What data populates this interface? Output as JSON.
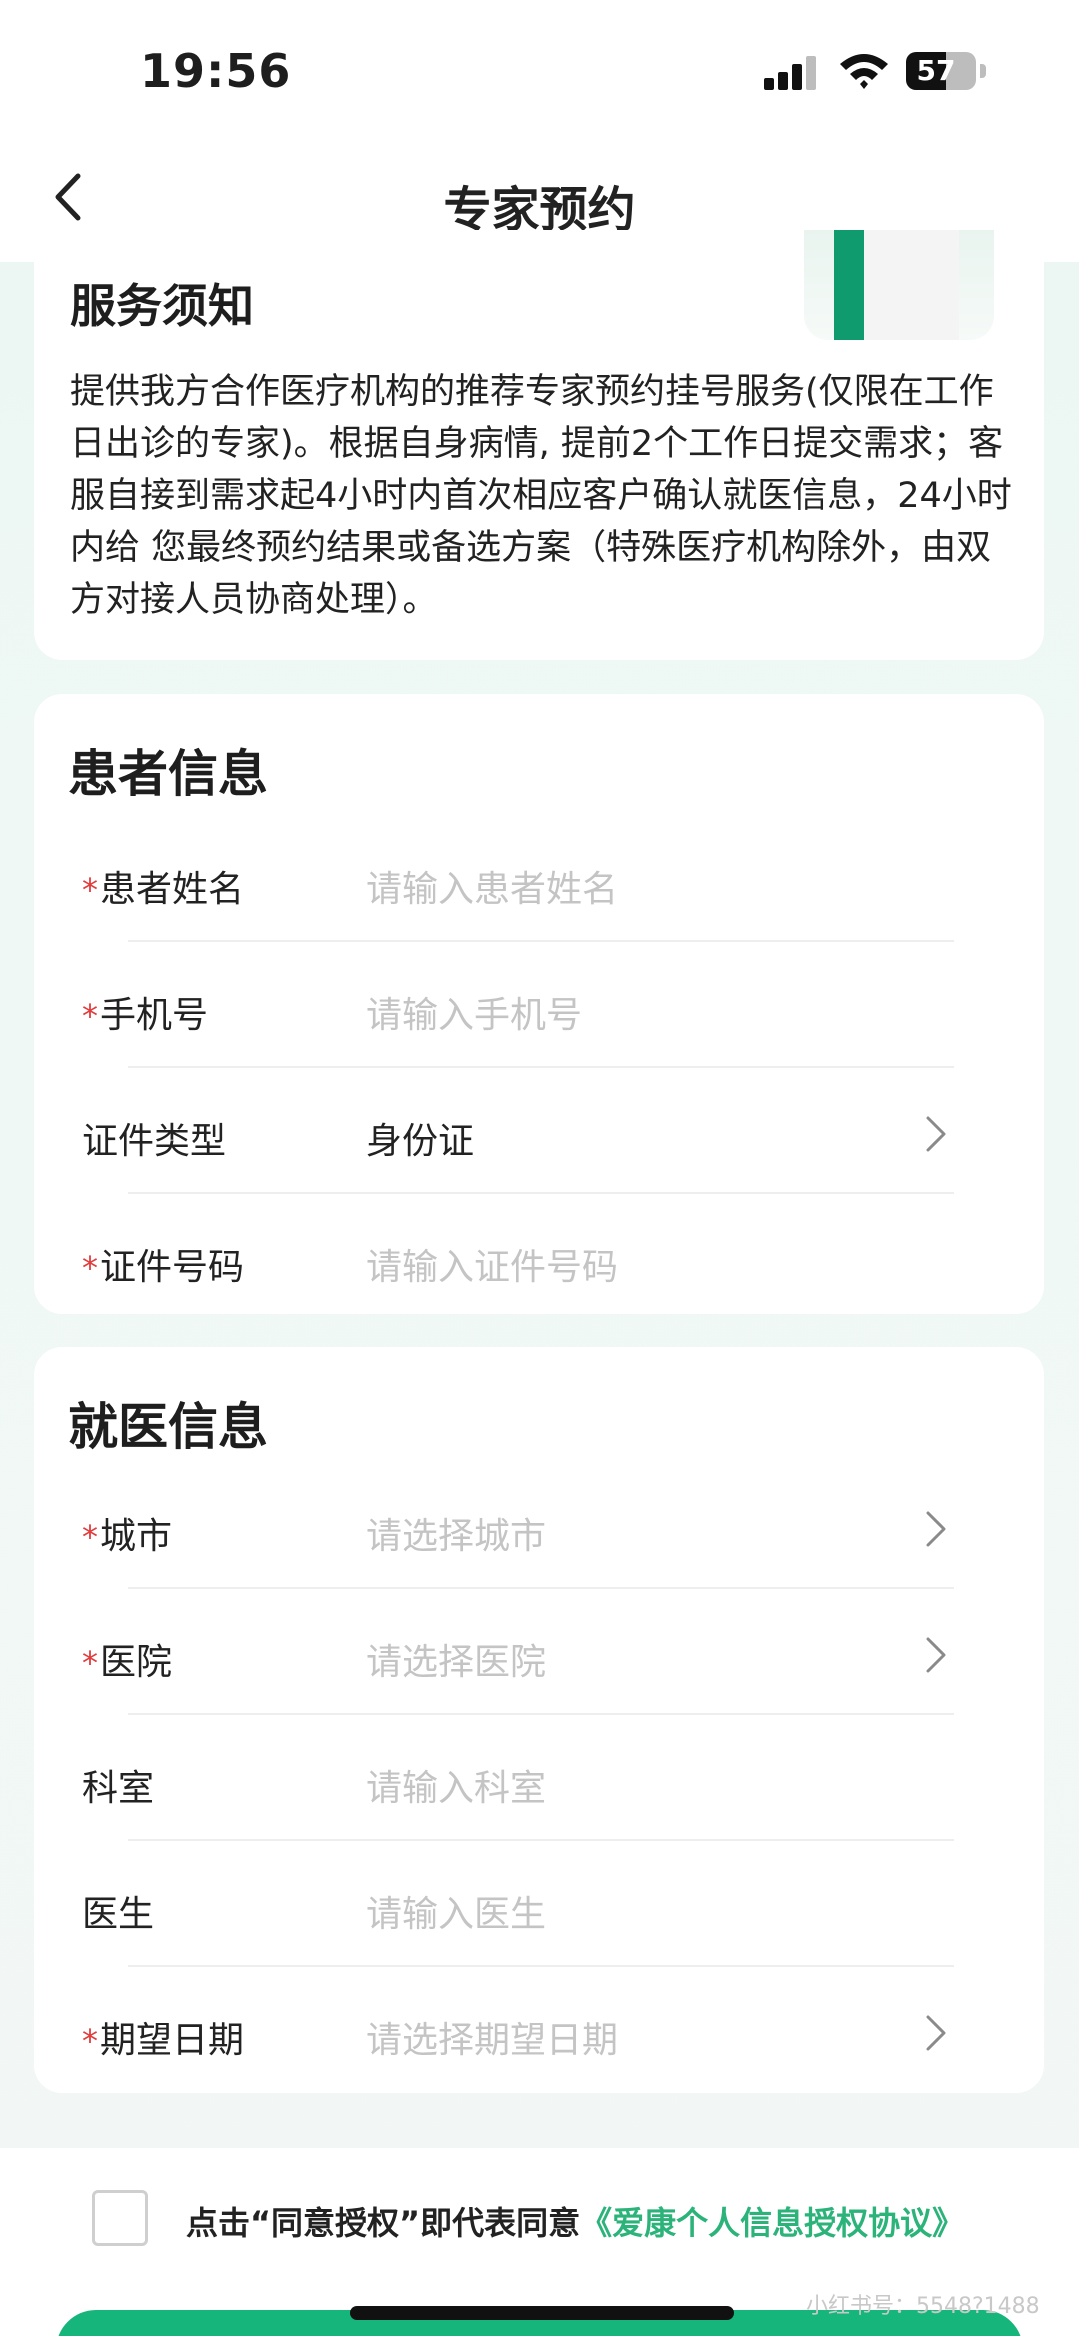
{
  "status_bar": {
    "time": "19:56",
    "battery": "57"
  },
  "nav": {
    "title": "专家预约"
  },
  "notice": {
    "title": "服务须知",
    "body": "提供我方合作医疗机构的推荐专家预约挂号服务(仅限在工作日出诊的专家)。根据自身病情, 提前2个工作日提交需求；客服自接到需求起4小时内首次相应客户确认就医信息，24小时内给 您最终预约结果或备选方案（特殊医疗机构除外，由双方对接人员协商处理）。"
  },
  "patient": {
    "title": "患者信息",
    "fields": [
      {
        "label": "患者姓名",
        "required": true,
        "placeholder": "请输入患者姓名"
      },
      {
        "label": "手机号",
        "required": true,
        "placeholder": "请输入手机号"
      },
      {
        "label": "证件类型",
        "required": false,
        "value": "身份证"
      },
      {
        "label": "证件号码",
        "required": true,
        "placeholder": "请输入证件号码"
      }
    ]
  },
  "medical": {
    "title": "就医信息",
    "fields": [
      {
        "label": "城市",
        "required": true,
        "placeholder": "请选择城市"
      },
      {
        "label": "医院",
        "required": true,
        "placeholder": "请选择医院"
      },
      {
        "label": "科室",
        "required": false,
        "placeholder": "请输入科室"
      },
      {
        "label": "医生",
        "required": false,
        "placeholder": "请输入医生"
      },
      {
        "label": "期望日期",
        "required": true,
        "placeholder": "请选择期望日期"
      }
    ]
  },
  "agreement": {
    "prefix": "点击“同意授权”即代表同意",
    "link": "《爱康个人信息授权协议》"
  },
  "required_mark": "*",
  "watermark": "小红书号：5548?1488",
  "colors": {
    "accent": "#16b57b",
    "link": "#2bb37a",
    "required": "#e23b3b",
    "placeholder": "#c4c4c4"
  }
}
